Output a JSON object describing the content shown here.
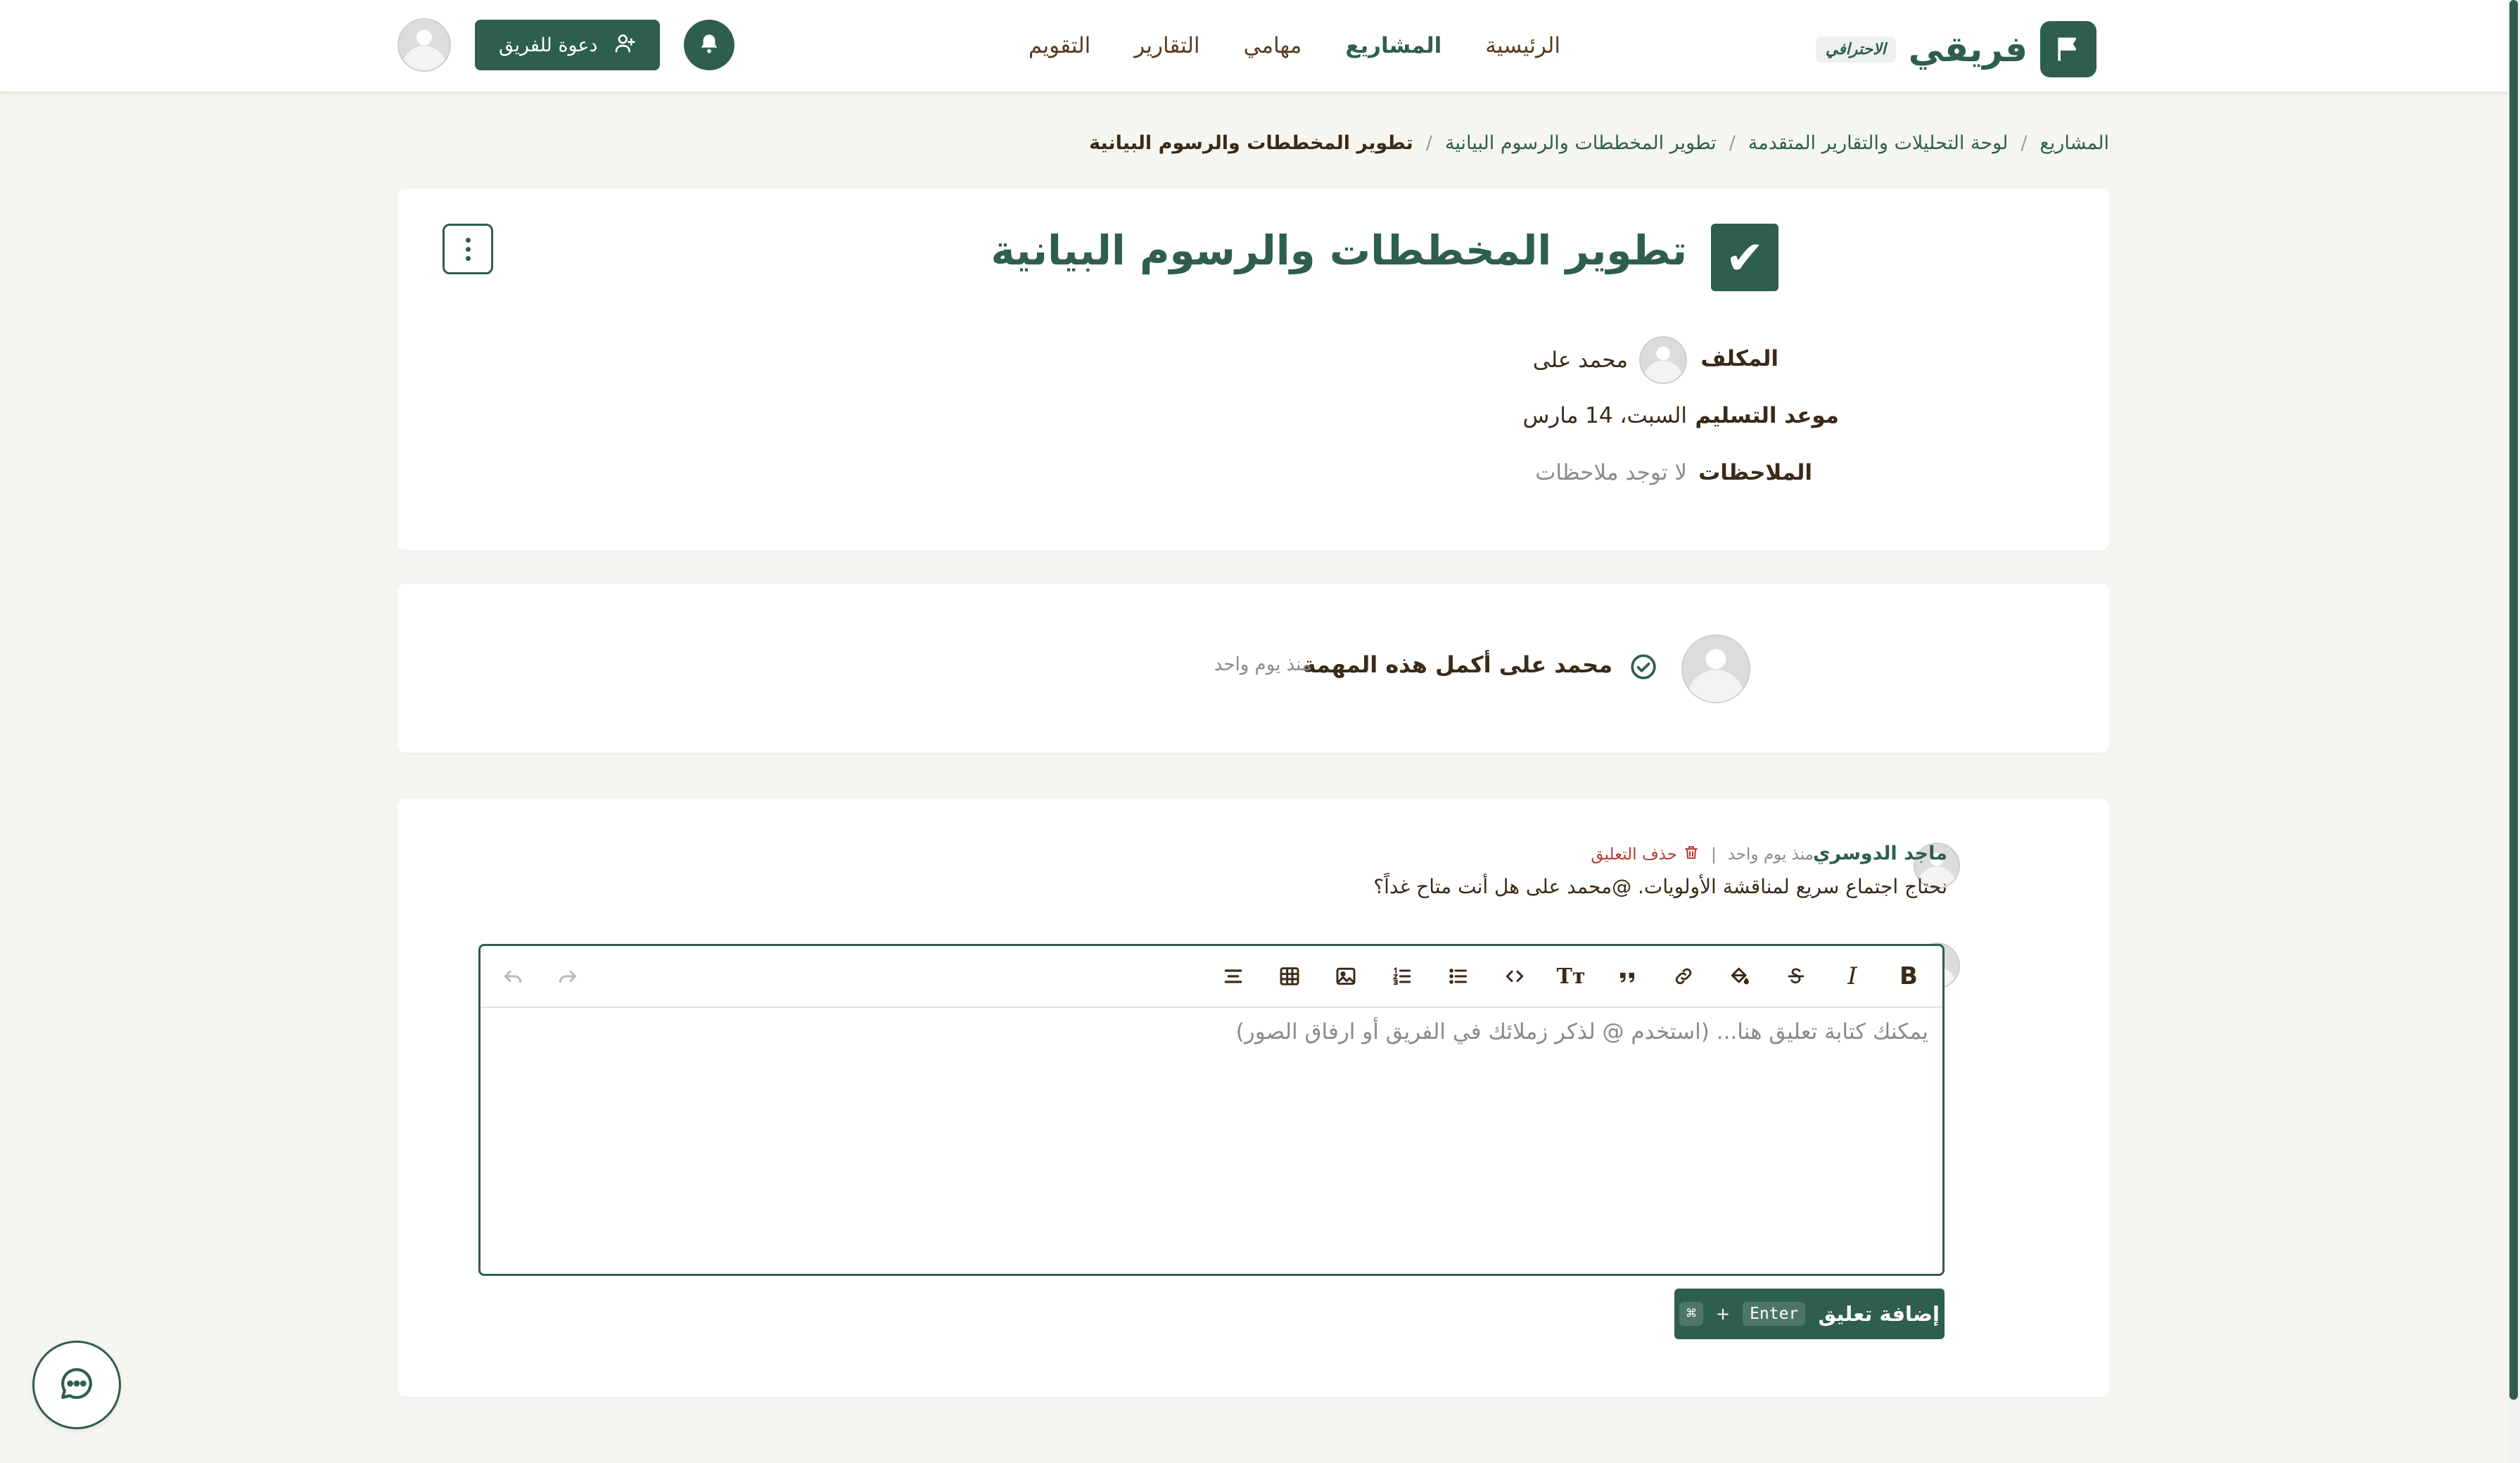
{
  "header": {
    "brand_name": "فريقي",
    "brand_badge": "الاحترافي",
    "nav": [
      {
        "label": "الرئيسية"
      },
      {
        "label": "المشاريع"
      },
      {
        "label": "مهامي"
      },
      {
        "label": "التقارير"
      },
      {
        "label": "التقويم"
      }
    ],
    "active_nav": "المشاريع",
    "invite_label": "دعوة للفريق"
  },
  "breadcrumb": [
    "المشاريع",
    "لوحة التحليلات والتقارير المتقدمة",
    "تطوير المخططات والرسوم البيانية",
    "تطوير المخططات والرسوم البيانية"
  ],
  "task": {
    "title": "تطوير المخططات والرسوم البيانية",
    "assignee_label": "المكلف",
    "assignee_name": "محمد على",
    "due_label": "موعد التسليم",
    "due_value": "السبت، 14 مارس",
    "notes_label": "الملاحظات",
    "notes_value": "لا توجد ملاحظات"
  },
  "activity": {
    "text": "محمد على أكمل هذه المهمة",
    "time": "منذ يوم واحد"
  },
  "comments": [
    {
      "author": "ماجد الدوسري",
      "time": "منذ يوم واحد",
      "delete_label": "حذف التعليق",
      "body": "نحتاج اجتماع سريع لمناقشة الأولويات. @محمد على هل أنت متاح غداً؟"
    }
  ],
  "editor": {
    "placeholder": "يمكنك كتابة تعليق هنا... (استخدم @ لذكر زملائك في الفريق أو ارفاق الصور)",
    "submit_label": "إضافة تعليق",
    "shortcut_key": "Enter",
    "shortcut_mod": "⌘",
    "shortcut_plus": "+",
    "tools": {
      "bold": "B",
      "italic": "I",
      "text_size": "Tт"
    }
  },
  "colors": {
    "primary": "#2e5e4e",
    "background": "#f6f6f1",
    "text": "#3a2a18",
    "danger": "#b83a2e"
  }
}
